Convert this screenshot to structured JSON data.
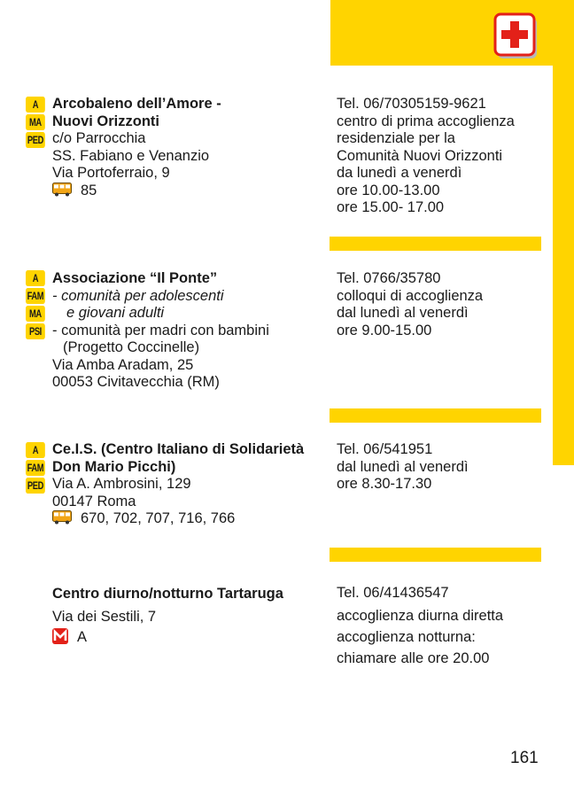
{
  "colors": {
    "accent": "#FFD400",
    "red": "#E32119"
  },
  "header_icon": "first-aid-cross-icon",
  "entries": [
    {
      "tags": [
        "A",
        "MA",
        "PED"
      ],
      "name_lines": [
        "Arcobaleno dell’Amore -",
        "Nuovi Orizzonti"
      ],
      "address_lines": [
        "c/o  Parrocchia",
        "SS. Fabiano e Venanzio",
        "Via Portoferraio, 9"
      ],
      "transport": {
        "icon": "bus-icon",
        "text": "85"
      },
      "info_lines": [
        "Tel. 06/70305159-9621",
        "centro di prima accoglienza",
        "residenziale per la",
        "Comunità Nuovi Orizzonti",
        "da lunedì a venerdì",
        "ore 10.00-13.00",
        "ore 15.00- 17.00"
      ]
    },
    {
      "tags": [
        "A",
        "FAM",
        "MA",
        "PSI"
      ],
      "name_lines": [
        "Associazione “Il Ponte”"
      ],
      "detail_lines": [
        "- comunità per adolescenti",
        "e giovani adulti",
        "- comunità per madri con bambini",
        "(Progetto Coccinelle)"
      ],
      "address_lines": [
        "Via Amba Aradam, 25",
        "00053 Civitavecchia (RM)"
      ],
      "info_lines": [
        "Tel. 0766/35780",
        "colloqui di accoglienza",
        "dal lunedì al venerdì",
        "ore 9.00-15.00"
      ]
    },
    {
      "tags": [
        "A",
        "FAM",
        "PED"
      ],
      "name_lines": [
        "Ce.I.S. (Centro Italiano di Solidarietà",
        "Don Mario Picchi)"
      ],
      "address_lines": [
        "Via A. Ambrosini, 129",
        "00147 Roma"
      ],
      "transport": {
        "icon": "bus-icon",
        "text": "670, 702, 707, 716, 766"
      },
      "info_lines": [
        "Tel. 06/541951",
        "dal lunedì al venerdì",
        "ore 8.30-17.30"
      ]
    },
    {
      "tags": [],
      "name_lines": [
        "Centro diurno/notturno Tartaruga"
      ],
      "address_lines": [
        "Via dei Sestili, 7"
      ],
      "transport": {
        "icon": "metro-icon",
        "text": "A"
      },
      "info_lines": [
        "Tel. 06/41436547",
        "accoglienza diurna diretta",
        "accoglienza notturna:",
        "chiamare alle ore 20.00"
      ]
    }
  ],
  "page_number": "161"
}
